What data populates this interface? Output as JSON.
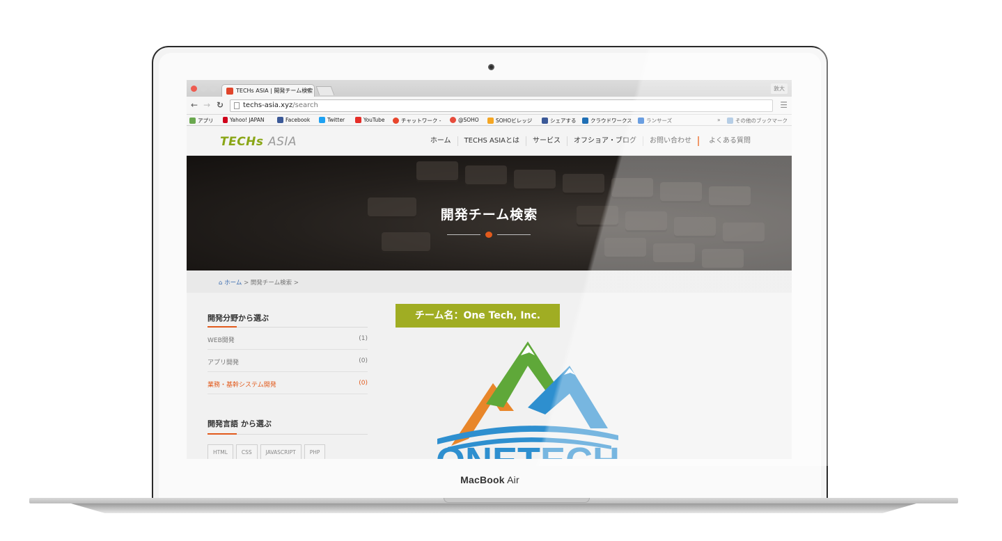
{
  "device": {
    "brand_bold": "MacBook",
    "brand_light": "Air"
  },
  "browser": {
    "tab_title": "TECHs ASIA | 開発チーム検索",
    "tab_close": "×",
    "profile": "敦大",
    "url_host": "techs-asia.xyz",
    "url_path": "/search",
    "bookmarks": [
      {
        "label": "アプリ",
        "color": "#6aa84f"
      },
      {
        "label": "Yahoo! JAPAN",
        "color": "#d0021b"
      },
      {
        "label": "Facebook",
        "color": "#3b5998"
      },
      {
        "label": "Twitter",
        "color": "#1da1f2"
      },
      {
        "label": "YouTube",
        "color": "#e52d27"
      },
      {
        "label": "チャットワーク -",
        "color": "#e8452c"
      },
      {
        "label": "@SOHO",
        "color": "#e74c3c"
      },
      {
        "label": "SOHOビレッジ",
        "color": "#f5a623"
      },
      {
        "label": "シェアする",
        "color": "#3b5998"
      },
      {
        "label": "クラウドワークス",
        "color": "#1f6fb5"
      },
      {
        "label": "ランサーズ",
        "color": "#1a6ad1"
      }
    ],
    "bookmarks_more": "»",
    "other_bookmarks": "その他のブックマーク"
  },
  "site": {
    "logo_part1": "TECHs",
    "logo_part2": "ASIA",
    "nav": [
      "ホーム",
      "TECHS ASIAとは",
      "サービス",
      "オフショア・ブログ",
      "お問い合わせ",
      "よくある質問"
    ]
  },
  "hero": {
    "title": "開発チーム検索"
  },
  "breadcrumb": {
    "home": "ホーム",
    "sep": ">",
    "current": "開発チーム検索",
    "trail": ">"
  },
  "sidebar": {
    "section1_title": "開発分野から選ぶ",
    "categories": [
      {
        "label": "WEB開発",
        "count": "(1)"
      },
      {
        "label": "アプリ開発",
        "count": "(0)"
      },
      {
        "label": "業務・基幹システム開発",
        "count": "(0)"
      }
    ],
    "section2_title": "開発言語 から選ぶ",
    "tags": [
      "HTML",
      "CSS",
      "JAVASCRIPT",
      "PHP"
    ]
  },
  "team": {
    "label": "チーム名：One Tech, Inc.",
    "logo_text": "ONETECH"
  },
  "colors": {
    "accent": "#e25a1c",
    "team_label_bg": "#a0ad23",
    "logo_green": "#8aa617"
  }
}
